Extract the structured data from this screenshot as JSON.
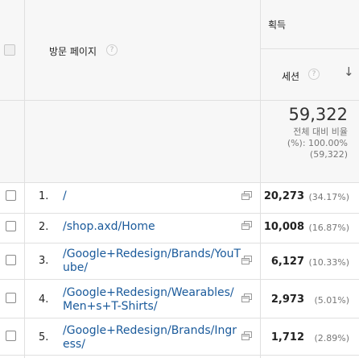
{
  "header": {
    "group_label": "획득",
    "page_col_label": "방문 페이지",
    "sessions_label": "세션",
    "help_glyph": "?",
    "sort_glyph": "↓"
  },
  "totals": {
    "value": "59,322",
    "pct_line1": "전체 대비 비율",
    "pct_line2": "(%): 100.00%",
    "pct_line3": "(59,322)"
  },
  "rows": [
    {
      "num": "1.",
      "page": "/",
      "sessions": "20,273",
      "pct": "(34.17%)"
    },
    {
      "num": "2.",
      "page": "/shop.axd/Home",
      "sessions": "10,008",
      "pct": "(16.87%)"
    },
    {
      "num": "3.",
      "page": "/Google+Redesign/Brands/YouTube/",
      "sessions": "6,127",
      "pct": "(10.33%)"
    },
    {
      "num": "4.",
      "page": "/Google+Redesign/Wearables/Men+s+T-Shirts/",
      "sessions": "2,973",
      "pct": "(5.01%)"
    },
    {
      "num": "5.",
      "page": "/Google+Redesign/Brands/Ingress/",
      "sessions": "1,712",
      "pct": "(2.89%)"
    }
  ]
}
